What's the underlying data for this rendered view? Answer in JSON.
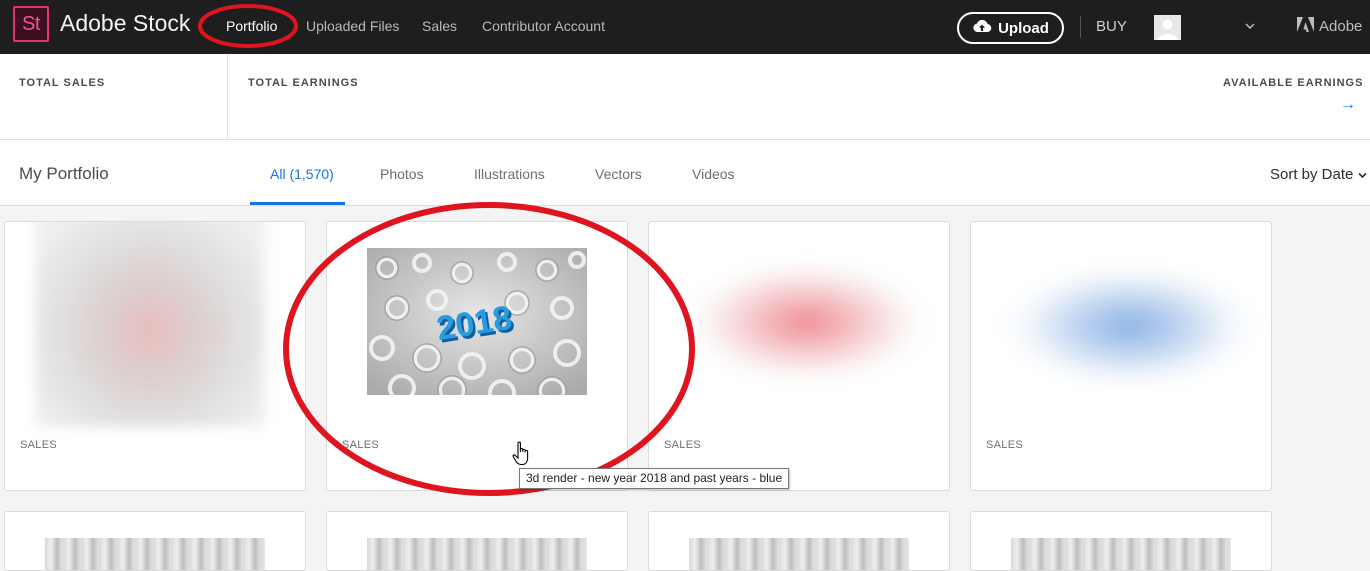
{
  "app": {
    "logo_text": "St",
    "brand": "Adobe Stock"
  },
  "nav": {
    "items": [
      {
        "label": "Portfolio",
        "active": true
      },
      {
        "label": "Uploaded Files",
        "active": false
      },
      {
        "label": "Sales",
        "active": false
      },
      {
        "label": "Contributor Account",
        "active": false
      }
    ],
    "upload_label": "Upload",
    "upload_icon": "cloud-upload-icon",
    "buy_label": "BUY",
    "adobe_label": "Adobe"
  },
  "earnings": {
    "total_sales_label": "TOTAL SALES",
    "total_earnings_label": "TOTAL EARNINGS",
    "available_earnings_label": "AVAILABLE EARNINGS",
    "arrow": "→"
  },
  "portfolio": {
    "title": "My Portfolio",
    "tabs": [
      {
        "label": "All (1,570)",
        "active": true
      },
      {
        "label": "Photos",
        "active": false
      },
      {
        "label": "Illustrations",
        "active": false
      },
      {
        "label": "Vectors",
        "active": false
      },
      {
        "label": "Videos",
        "active": false
      }
    ],
    "sort_label": "Sort by Date"
  },
  "cards": [
    {
      "sales_label": "SALES"
    },
    {
      "sales_label": "SALES",
      "image_text": "2018"
    },
    {
      "sales_label": "SALES"
    },
    {
      "sales_label": "SALES"
    }
  ],
  "tooltip": "3d render - new year 2018 and past years - blue",
  "colors": {
    "accent": "#1473e6",
    "annotation": "#e0141e",
    "topbar": "#1e1e1e"
  }
}
